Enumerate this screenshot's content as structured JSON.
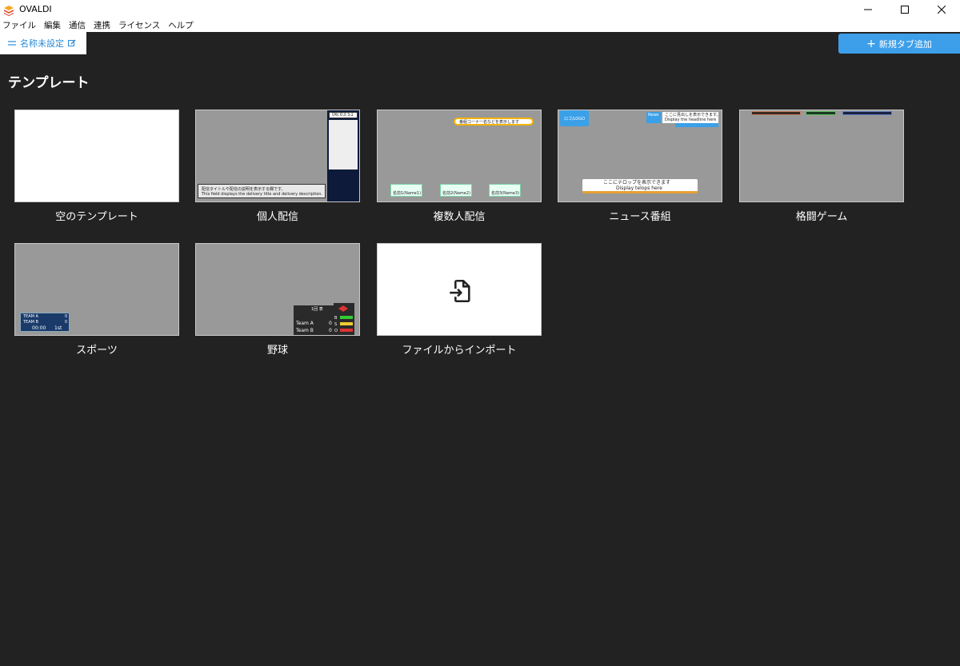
{
  "window": {
    "title": "OVALDI"
  },
  "menu": [
    "ファイル",
    "編集",
    "通信",
    "連携",
    "ライセンス",
    "ヘルプ"
  ],
  "tab": {
    "label": "名称未設定"
  },
  "add_tab": {
    "label": "新規タブ追加"
  },
  "section": {
    "title": "テンプレート"
  },
  "templates": [
    {
      "label": "空のテンプレート"
    },
    {
      "label": "個人配信"
    },
    {
      "label": "複数人配信"
    },
    {
      "label": "ニュース番組"
    },
    {
      "label": "格闘ゲーム"
    },
    {
      "label": "スポーツ"
    },
    {
      "label": "野球"
    },
    {
      "label": "ファイルからインポート"
    }
  ],
  "thumb_text": {
    "personal_time": "06:03:51",
    "personal_caption_ja": "配信タイトルや配信の説明を表示する欄です。",
    "personal_caption_en": "This field displays the delivery title and delivery description.",
    "multi_corner": "番組コーナー名などを表示します",
    "multi_names": [
      "名前1(Name1)",
      "名前2(Name2)",
      "名前3(Name3)"
    ],
    "news_logo": "ロゴ/LOGO",
    "news_badge": "News",
    "news_headline_ja": "ここに見出しを表示できます。",
    "news_headline_en": "Display the headline here",
    "news_telop_ja": "ここにテロップを表示できます",
    "news_telop_en": "Display telops here",
    "sports_team_a": "TEAM A",
    "sports_team_b": "TEAM B",
    "sports_score_a": "0",
    "sports_score_b": "0",
    "sports_clock": "00:00",
    "sports_period": "1st",
    "baseball_inning": "1回 表",
    "baseball_team_a": "Team A",
    "baseball_team_b": "Team B",
    "baseball_score_a": "0",
    "baseball_score_b": "0",
    "baseball_b": "B",
    "baseball_s": "S",
    "baseball_o": "O"
  },
  "colors": {
    "background": "#222222",
    "accent": "#3d9fea",
    "tab_text": "#2b8bd8"
  }
}
